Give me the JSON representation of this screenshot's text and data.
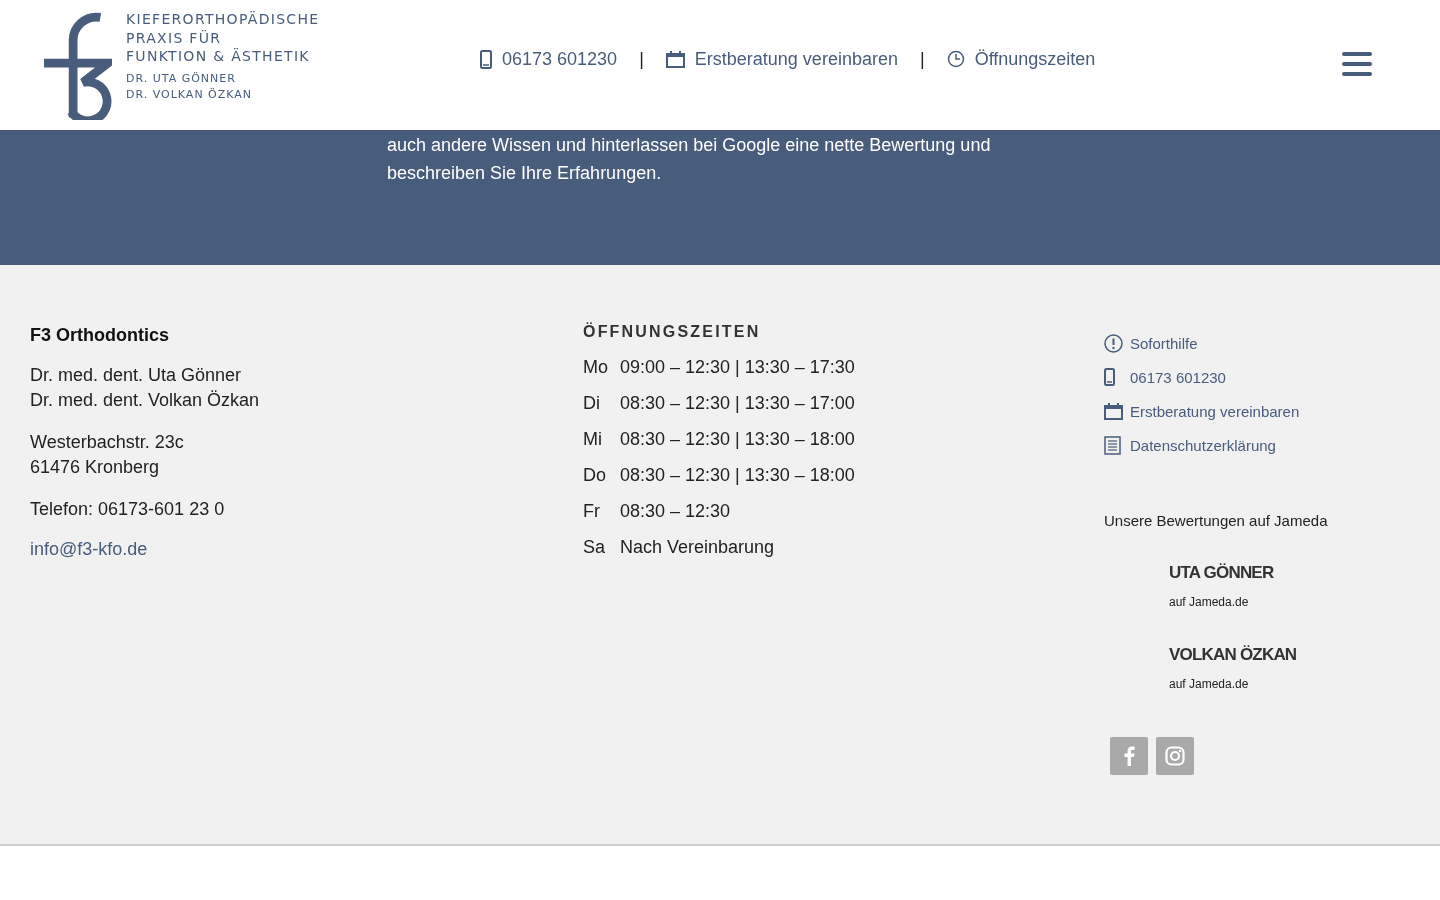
{
  "header": {
    "logo": {
      "lines": [
        "KIEFERORTHOPÄDISCHE",
        "PRAXIS FÜR",
        "FUNKTION & ÄSTHETIK"
      ],
      "doctors": [
        "DR. UTA GÖNNER",
        "DR. VOLKAN ÖZKAN"
      ]
    },
    "nav": [
      {
        "kind": "phone",
        "label": "06173 601230"
      },
      {
        "kind": "calendar",
        "label": "Erstberatung vereinbaren"
      },
      {
        "kind": "clock",
        "label": "Öffnungszeiten"
      }
    ],
    "separator": "|"
  },
  "band": {
    "lines": [
      "auch andere Wissen und hinterlassen bei Google eine nette Bewertung und",
      "beschreiben Sie Ihre Erfahrungen."
    ]
  },
  "footer": {
    "contact": {
      "name": "F3 Orthodontics",
      "doctors": [
        "Dr. med. dent. Uta Gönner",
        "Dr. med. dent. Volkan Özkan"
      ],
      "address": [
        "Westerbachstr. 23c",
        "61476 Kronberg"
      ],
      "phone": "Telefon: 06173-601 23 0",
      "email": "info@f3-kfo.de"
    },
    "hours": {
      "title": "ÖFFNUNGSZEITEN",
      "rows": [
        {
          "day": "Mo",
          "time": "09:00 – 12:30 | 13:30 – 17:30"
        },
        {
          "day": "Di",
          "time": "08:30 – 12:30 | 13:30 – 17:00"
        },
        {
          "day": "Mi",
          "time": "08:30 – 12:30 | 13:30 – 18:00"
        },
        {
          "day": "Do",
          "time": "08:30 – 12:30 | 13:30 – 18:00"
        },
        {
          "day": "Fr",
          "time": "08:30 – 12:30"
        },
        {
          "day": "Sa",
          "time": "Nach Vereinbarung"
        }
      ]
    },
    "links": [
      {
        "kind": "alert",
        "label": "Soforthilfe"
      },
      {
        "kind": "phone",
        "label": "06173 601230"
      },
      {
        "kind": "calendar",
        "label": "Erstberatung vereinbaren"
      },
      {
        "kind": "document",
        "label": "Datenschutzerklärung"
      }
    ],
    "reviews_title": "Unsere Bewertungen auf Jameda",
    "reviews": [
      {
        "name": "UTA GÖNNER",
        "sub": "auf Jameda.de"
      },
      {
        "name": "VOLKAN ÖZKAN",
        "sub": "auf Jameda.de"
      }
    ],
    "social": [
      {
        "kind": "facebook"
      },
      {
        "kind": "instagram"
      }
    ]
  }
}
